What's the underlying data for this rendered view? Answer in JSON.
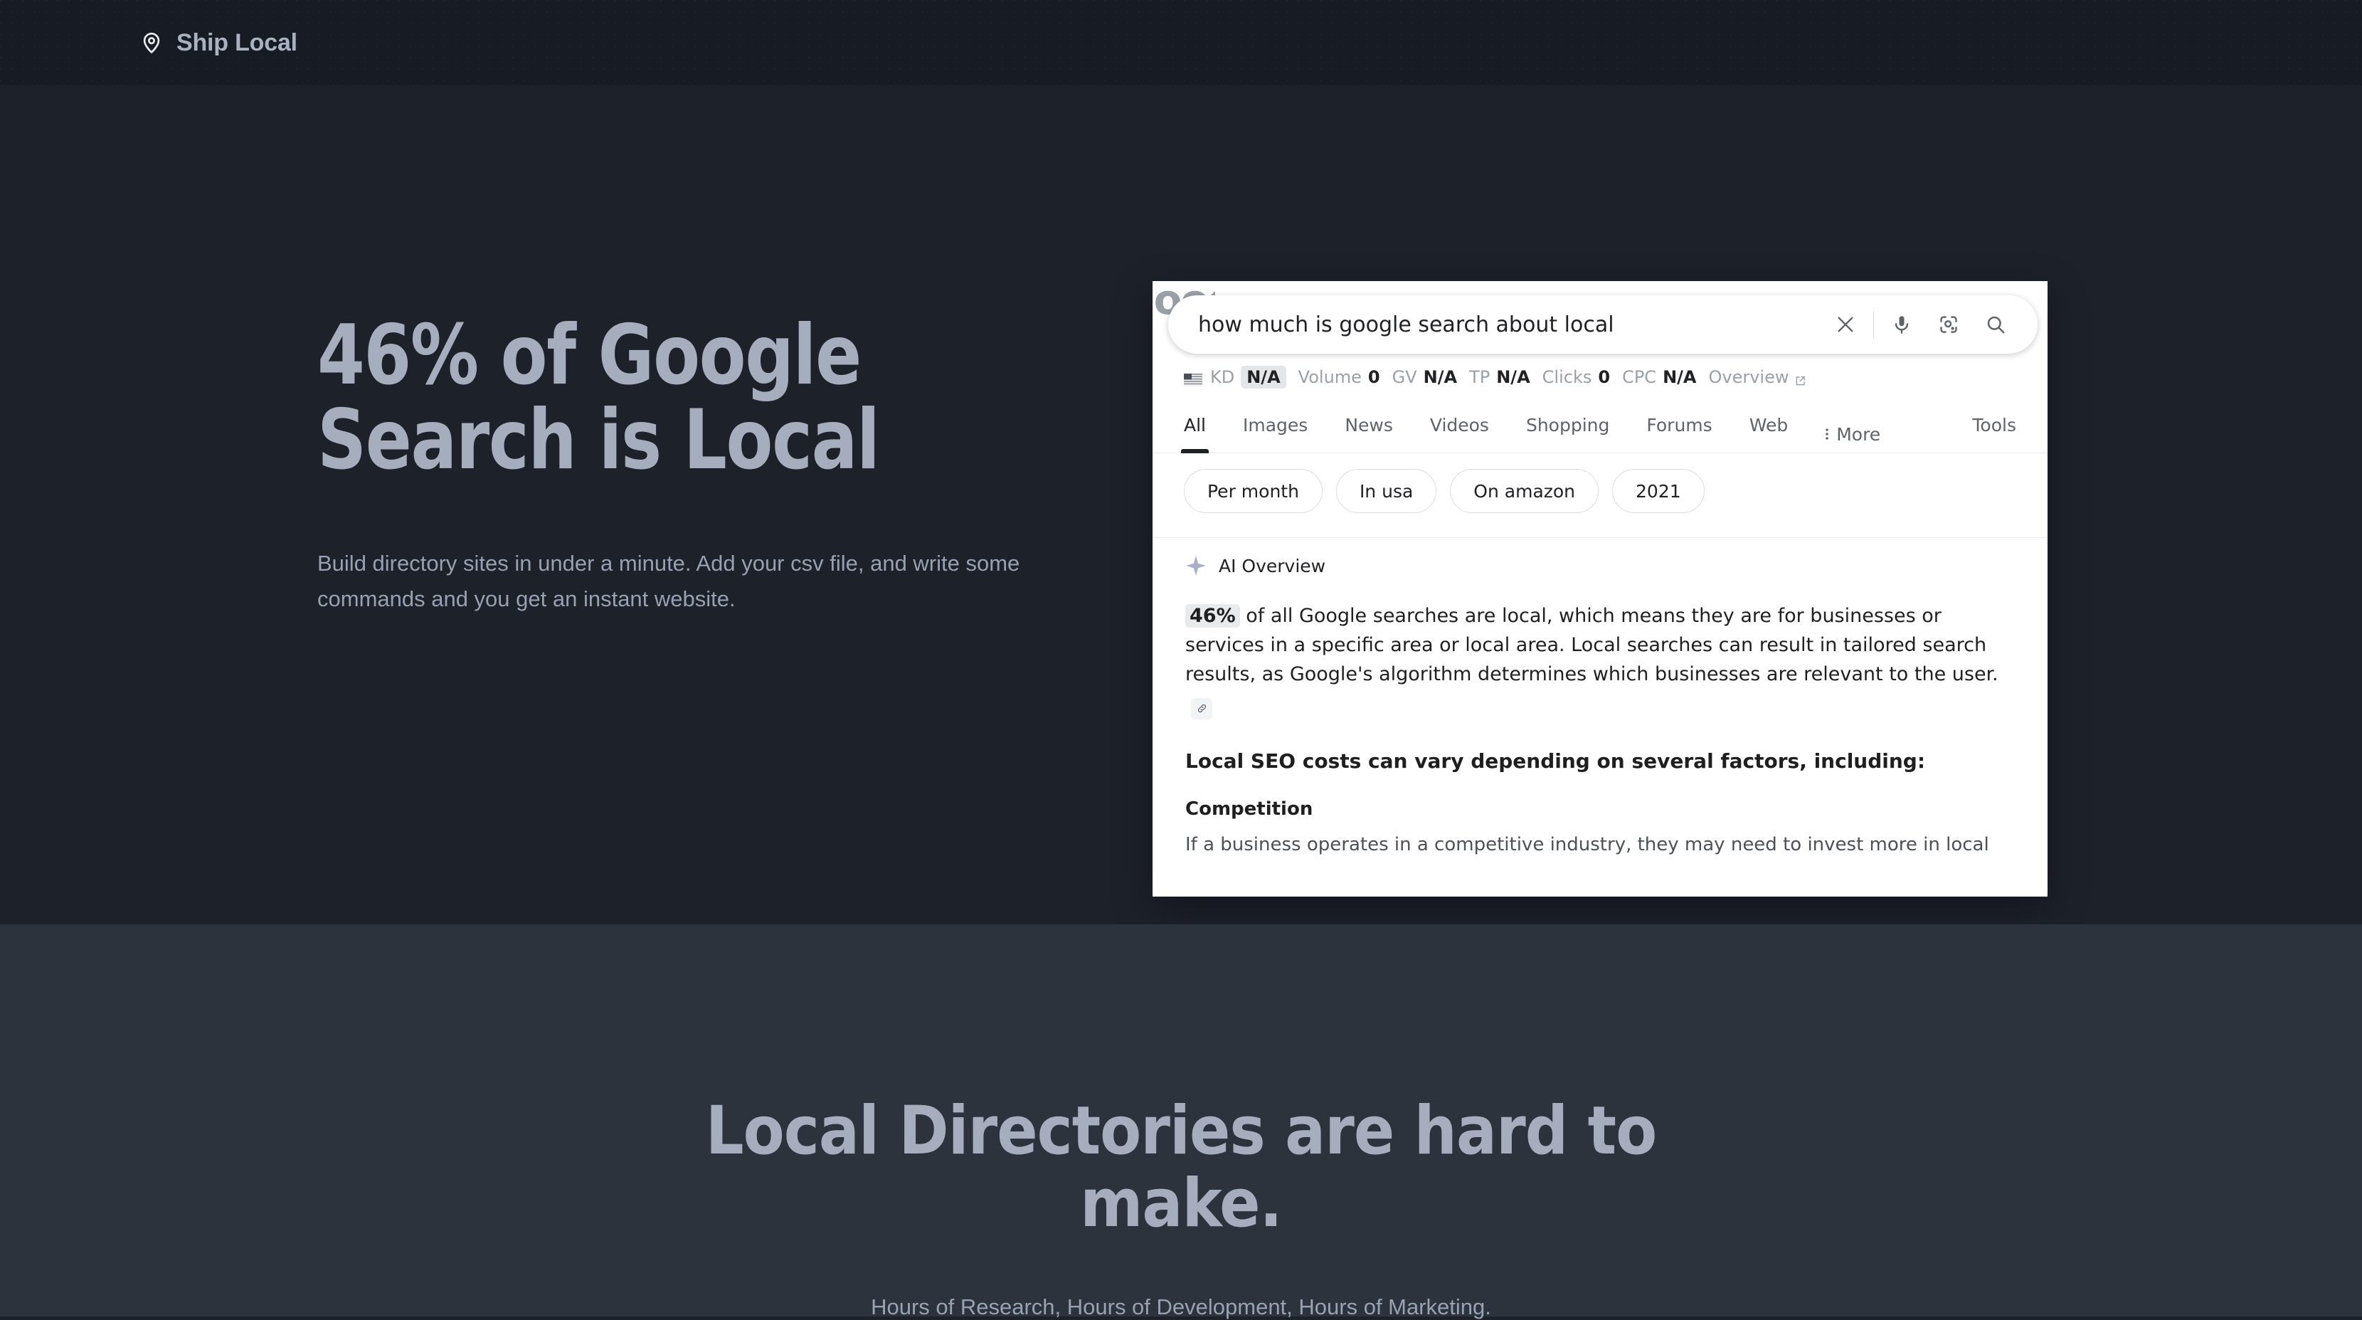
{
  "header": {
    "brand": "Ship Local",
    "pin_icon": "location-pin-icon"
  },
  "hero": {
    "title_line1": "46% of Google",
    "title_line2": "Search is Local",
    "subtitle": "Build directory sites in under a minute. Add your csv file, and write some commands and you get an instant website."
  },
  "serp": {
    "logo_text": "Google",
    "search": {
      "query": "how much is google search about local",
      "clear_icon": "close-icon",
      "mic_icon": "microphone-icon",
      "lens_icon": "google-lens-icon",
      "search_icon": "search-icon"
    },
    "metrics": {
      "flag_icon": "us-flag-icon",
      "items": [
        {
          "label": "KD",
          "value": "N/A",
          "badge": true
        },
        {
          "label": "Volume",
          "value": "0",
          "badge": false
        },
        {
          "label": "GV",
          "value": "N/A",
          "badge": false
        },
        {
          "label": "TP",
          "value": "N/A",
          "badge": false
        },
        {
          "label": "Clicks",
          "value": "0",
          "badge": false
        },
        {
          "label": "CPC",
          "value": "N/A",
          "badge": false
        }
      ],
      "overview_label": "Overview",
      "external_icon": "external-link-icon"
    },
    "tabs": [
      {
        "label": "All",
        "active": true
      },
      {
        "label": "Images",
        "active": false
      },
      {
        "label": "News",
        "active": false
      },
      {
        "label": "Videos",
        "active": false
      },
      {
        "label": "Shopping",
        "active": false
      },
      {
        "label": "Forums",
        "active": false
      },
      {
        "label": "Web",
        "active": false
      }
    ],
    "more_label": "More",
    "more_icon": "vertical-dots-icon",
    "tools_label": "Tools",
    "chips": [
      "Per month",
      "In usa",
      "On amazon",
      "2021"
    ],
    "ai_overview": {
      "icon": "sparkle-icon",
      "title": "AI Overview",
      "highlight": "46%",
      "paragraph": " of all Google searches are local, which means they are for businesses or services in a specific area or local area. Local searches can result in tailored search results, as Google's algorithm determines which businesses are relevant to the user.",
      "cite_icon": "link-icon",
      "subheading": "Local SEO costs can vary depending on several factors, including:",
      "section_title": "Competition",
      "section_body": "If a business operates in a competitive industry, they may need to invest more in local"
    }
  },
  "section_two": {
    "title": "Local Directories are hard to make.",
    "subtitle": "Hours of Research, Hours of Development, Hours of Marketing."
  },
  "colors": {
    "header_bg": "#161b24",
    "hero_bg": "#1d212a",
    "section_two_bg": "#2c333d",
    "heading_text": "#a6aebd",
    "body_text": "#98a1b1",
    "card_bg": "#ffffff"
  }
}
